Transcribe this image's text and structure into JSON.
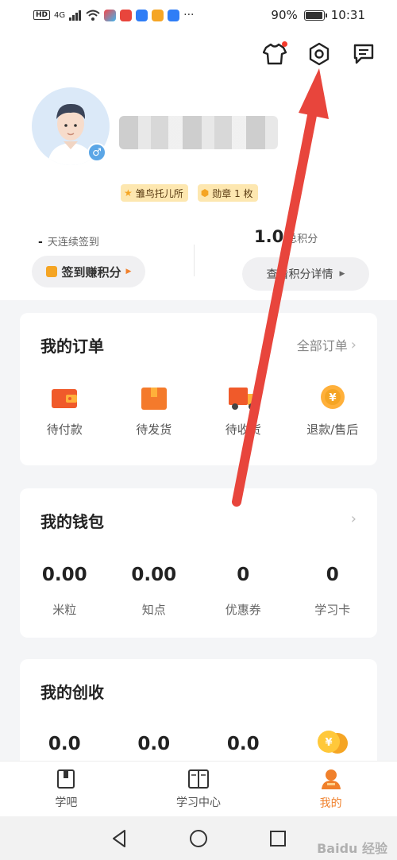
{
  "status_bar": {
    "hd": "HD",
    "signal": "4G",
    "battery": "90%",
    "battery_level": 0.9,
    "time": "10:31"
  },
  "header_icons": [
    "shirt-icon",
    "settings-icon",
    "message-icon"
  ],
  "profile": {
    "gender_symbol": "♂",
    "badges": [
      {
        "label": "雏鸟托儿所",
        "icon": "star-icon"
      },
      {
        "label": "勋章 1 枚",
        "icon": "medal-icon"
      }
    ]
  },
  "checkin": {
    "days": "-",
    "label": "天连续签到",
    "button": "签到赚积分"
  },
  "points": {
    "value": "1.0",
    "label": "总积分",
    "detail_button": "查看积分详情"
  },
  "orders": {
    "title": "我的订单",
    "more": "全部订单",
    "items": [
      {
        "label": "待付款",
        "icon": "wallet-icon"
      },
      {
        "label": "待发货",
        "icon": "box-icon"
      },
      {
        "label": "待收货",
        "icon": "truck-icon"
      },
      {
        "label": "退款/售后",
        "icon": "refund-icon"
      }
    ]
  },
  "wallet": {
    "title": "我的钱包",
    "items": [
      {
        "value": "0.00",
        "label": "米粒"
      },
      {
        "value": "0.00",
        "label": "知点"
      },
      {
        "value": "0",
        "label": "优惠券"
      },
      {
        "value": "0",
        "label": "学习卡"
      }
    ]
  },
  "earnings": {
    "title": "我的创收",
    "values": [
      "0.0",
      "0.0",
      "0.0"
    ]
  },
  "tabs": [
    {
      "label": "学吧",
      "icon": "book-icon"
    },
    {
      "label": "学习中心",
      "icon": "open-book-icon"
    },
    {
      "label": "我的",
      "icon": "person-icon",
      "active": true
    }
  ],
  "watermark": "Baidu 经验",
  "colors": {
    "accent": "#f0802b",
    "arrow": "#e8453c",
    "badge_bg": "#fde7b0"
  }
}
